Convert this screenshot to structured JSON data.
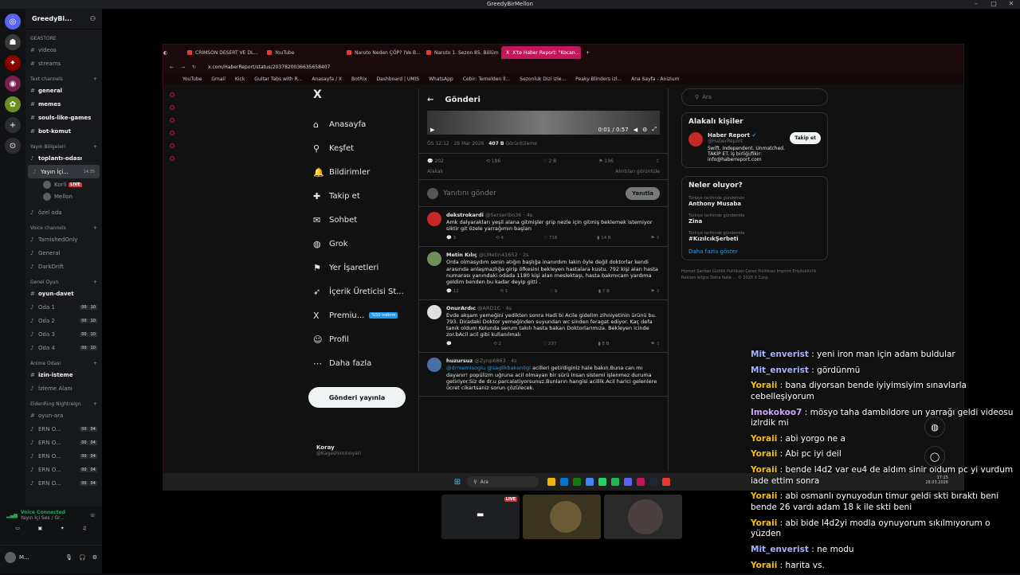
{
  "window": {
    "title": "GreedyBirMellon"
  },
  "server": {
    "name": "GreedyBi...",
    "sections": [
      {
        "category": "GEASTORE",
        "channels": [
          {
            "icon": "#",
            "name": "videos"
          },
          {
            "icon": "#",
            "name": "streams"
          }
        ]
      },
      {
        "category": "Text channels",
        "channels": [
          {
            "icon": "#",
            "name": "general",
            "bold": true
          },
          {
            "icon": "#",
            "name": "memes",
            "bold": true
          },
          {
            "icon": "#",
            "name": "souls-like-games",
            "bold": true
          },
          {
            "icon": "#",
            "name": "bot-komut",
            "bold": true
          }
        ]
      }
    ],
    "voice_region": {
      "category": "Yayın Bölgeleri",
      "channels": [
        {
          "name": "toplantı-odası"
        },
        {
          "name": "Yayın İçi...",
          "time": "14:35",
          "active": true
        }
      ],
      "users": [
        {
          "name": "Korli",
          "live": "LIVE"
        },
        {
          "name": "Mellon"
        }
      ]
    },
    "misc": "özel oda",
    "voice_channels": {
      "category": "Voice channels",
      "items": [
        "TarnishedOnly",
        "General",
        "DarkDrift"
      ]
    },
    "genel_oyun": {
      "category": "Genel Oyun",
      "first": "oyun-davet",
      "rooms": [
        {
          "name": "Oda 1",
          "a": "00",
          "b": "10"
        },
        {
          "name": "Oda 2",
          "a": "00",
          "b": "10"
        },
        {
          "name": "Oda 3",
          "a": "00",
          "b": "10"
        },
        {
          "name": "Oda 4",
          "a": "00",
          "b": "10"
        }
      ]
    },
    "anime": {
      "category": "Anime Odası",
      "items": [
        "izin-isteme",
        "İzleme Alanı"
      ]
    },
    "eldenring": {
      "category": "EldenRing Nightreign",
      "first": "oyun-ara",
      "rooms": [
        {
          "name": "ERN O...",
          "a": "00",
          "b": "04"
        },
        {
          "name": "ERN O...",
          "a": "00",
          "b": "04"
        },
        {
          "name": "ERN O...",
          "a": "00",
          "b": "04"
        },
        {
          "name": "ERN O...",
          "a": "00",
          "b": "04"
        },
        {
          "name": "ERN O...",
          "a": "00",
          "b": "04"
        }
      ]
    },
    "voice_status": {
      "title": "Voice Connected",
      "sub": "Yayın İçi Ses / Gr..."
    },
    "user": {
      "name": "M..."
    }
  },
  "browser": {
    "tabs": [
      "CRIMSON DESERT VE DL...",
      "YouTube",
      "Naruto Neden ÇÖP? (Ve B...",
      "Naruto 1. Sezon 85. Bölüm",
      "X'te Haber Report: \"Kocan..."
    ],
    "url": "x.com/HaberReport/status/2037820036635658407",
    "bookmarks": [
      "YouTube",
      "Gmail",
      "Kick",
      "Guitar Tabs with R...",
      "Anasayfa / X",
      "BotRix",
      "Dashboard | UMIS",
      "WhatsApp",
      "Cebir: Temelden İl...",
      "Sezonluk Dizi izle...",
      "Peaky Blinders izl...",
      "Ana Sayfa - Anizium"
    ]
  },
  "x": {
    "nav": [
      {
        "icon": "⌂",
        "label": "Anasayfa"
      },
      {
        "icon": "⚲",
        "label": "Keşfet"
      },
      {
        "icon": "🔔",
        "label": "Bildirimler"
      },
      {
        "icon": "✚",
        "label": "Takip et"
      },
      {
        "icon": "✉",
        "label": "Sohbet"
      },
      {
        "icon": "◍",
        "label": "Grok"
      },
      {
        "icon": "⚑",
        "label": "Yer İşaretleri"
      },
      {
        "icon": "➶",
        "label": "İçerik Üreticisi St..."
      },
      {
        "icon": "X",
        "label": "Premiu...",
        "badge": "%50 indirim"
      },
      {
        "icon": "☺",
        "label": "Profil"
      },
      {
        "icon": "⋯",
        "label": "Daha fazla"
      }
    ],
    "post_button": "Gönderi yayınla",
    "account": {
      "name": "Koray",
      "handle": "@Kageshiminoyari"
    },
    "header": "Gönderi",
    "video_time": "0:01 / 0:57",
    "meta": {
      "time": "ÖS 12:12 · 28 Mar 2026 · ",
      "views": "407 B",
      "views_label": " Görüntüleme"
    },
    "stats": [
      "202",
      "186",
      "2 B",
      "196"
    ],
    "related": "Alakalı",
    "quotes": "Alıntıları görüntüle",
    "reply_placeholder": "Yanıtını gönder",
    "reply_button": "Yanıtla",
    "tweets": [
      {
        "name": "dekstrokardi",
        "handle": "@Serseribo36 · 4s",
        "text": "Amk dalyarakları yeşil alana gitmişler grip nezle için gitmiş beklemek istemiyor siktir git özele yarrağımın başları",
        "acts": [
          "3",
          "4",
          "718",
          "14 B"
        ],
        "color": "#c62828"
      },
      {
        "name": "Metin Kılıç",
        "handle": "@LMetin41652 · 2s",
        "text": "Orda olmasydım senin atığın başlığa inanırdım  lakin öyle değil  doktorlar kendi arasında anlaşmazlığa girip öfkesini bekleyen hastalara kustu.  792 kişi  alan hasta numarası yanındaki odada 1180 kişi alan meslektaşı, hasta bakmıcam yardıma geldim benden bu kadar deyip  gitti .",
        "acts": [
          "12",
          "1",
          "9",
          "7 B"
        ],
        "color": "#6d8f5a"
      },
      {
        "name": "OnurArdıc",
        "handle": "@ARD1C · 4s",
        "text": "Evde akşam yemeğini yedikten sonra Hadi bi Acile gidelim zihniyetinin ürünü bu. 793. Diradaki Doktor yemeğinden suyundan wc sinden feragat ediyor. Kaç defa tanık oldum Kolunda serum takılı hasta bakan Doktorlarımıza. Bekleyen icinde zor.bAcil acil gibi kullanılmalı",
        "acts": [
          "",
          "2",
          "237",
          "8 B"
        ],
        "color": "#e0e0e0"
      },
      {
        "name": "huzursuz",
        "handle": "@Zynp6863 · 4s",
        "link": "@drmemisoglu @saglikbakanligi",
        "text": " acilleri getirdiginiz hale bakın.Buna can mı dayanır!\npopülizm uğruna acil olmayan bir sürü insan sistemi işlenmez duruma getiriyor.Siz de dr.u parcalatiyorsunuz.Bunların hangisi acillik.Acil harici gelenlere ücret cikartsaniz sorun çözülecek.",
        "acts": [
          "",
          "",
          "",
          ""
        ],
        "color": "#4a6fa5"
      }
    ],
    "search_placeholder": "Ara",
    "related_people": {
      "title": "Alakalı kişiler",
      "name": "Haber Report",
      "handle": "@HaberReport",
      "bio": "Swift. Independent. Unmatched. TAKİP ET. İş birliği/fikir: info@haberreport.com",
      "follow": "Takip et"
    },
    "trends": {
      "title": "Neler oluyor?",
      "items": [
        {
          "cat": "Türkiye tarihinde gündemde",
          "topic": "Anthony Musaba"
        },
        {
          "cat": "Türkiye tarihinde gündemde",
          "topic": "Zina"
        },
        {
          "cat": "Türkiye tarihinde gündemde",
          "topic": "#KızılcıkŞerbeti"
        }
      ],
      "more": "Daha fazla göster"
    },
    "footer": "Hizmet Şartları   Gizlilik Politikası   Çerez Politikası   Imprint   Erişilebilirlik   Reklam bilgisi   Daha fazla ...   © 2026 X Corp."
  },
  "taskbar": {
    "search": "Ara",
    "time": "17:25",
    "date": "28.03.2026"
  },
  "thumbs": {
    "live": "LIVE"
  },
  "chat": [
    {
      "user": "Mit_enverist",
      "cls": "u1",
      "text": " : yeni iron man için adam buldular"
    },
    {
      "user": "Mit_enverist",
      "cls": "u1",
      "text": " : gördünmü"
    },
    {
      "user": "Yoraii",
      "cls": "u2",
      "text": " : bana diyorsan bende iyiyimsiyim sınavlarla cebelleşiyorum"
    },
    {
      "user": "Imokokoo7",
      "cls": "u3",
      "text": " : mösyo taha dambıldore un yarrağı geldi videosu izlrdik mi"
    },
    {
      "user": "Yoraii",
      "cls": "u2",
      "text": " : abi yorgo ne a"
    },
    {
      "user": "Yoraii",
      "cls": "u2",
      "text": " : Abi pc iyi deil"
    },
    {
      "user": "Yoraii",
      "cls": "u2",
      "text": " : bende l4d2 var eu4 de aldım sinir oldum pc yi vurdum iade ettim sonra"
    },
    {
      "user": "Yoraii",
      "cls": "u2",
      "text": " : abi osmanlı oynuyodun timur geldi skti bıraktı beni bende 26 vardı adam 18 k ile skti beni"
    },
    {
      "user": "Yoraii",
      "cls": "u2",
      "text": " : abi bide l4d2yi modla oynuyorum sıkılmıyorum o yüzden"
    },
    {
      "user": "Mit_enverist",
      "cls": "u1",
      "text": " : ne modu"
    },
    {
      "user": "Yoraii",
      "cls": "u2",
      "text": " : harita vs."
    }
  ]
}
